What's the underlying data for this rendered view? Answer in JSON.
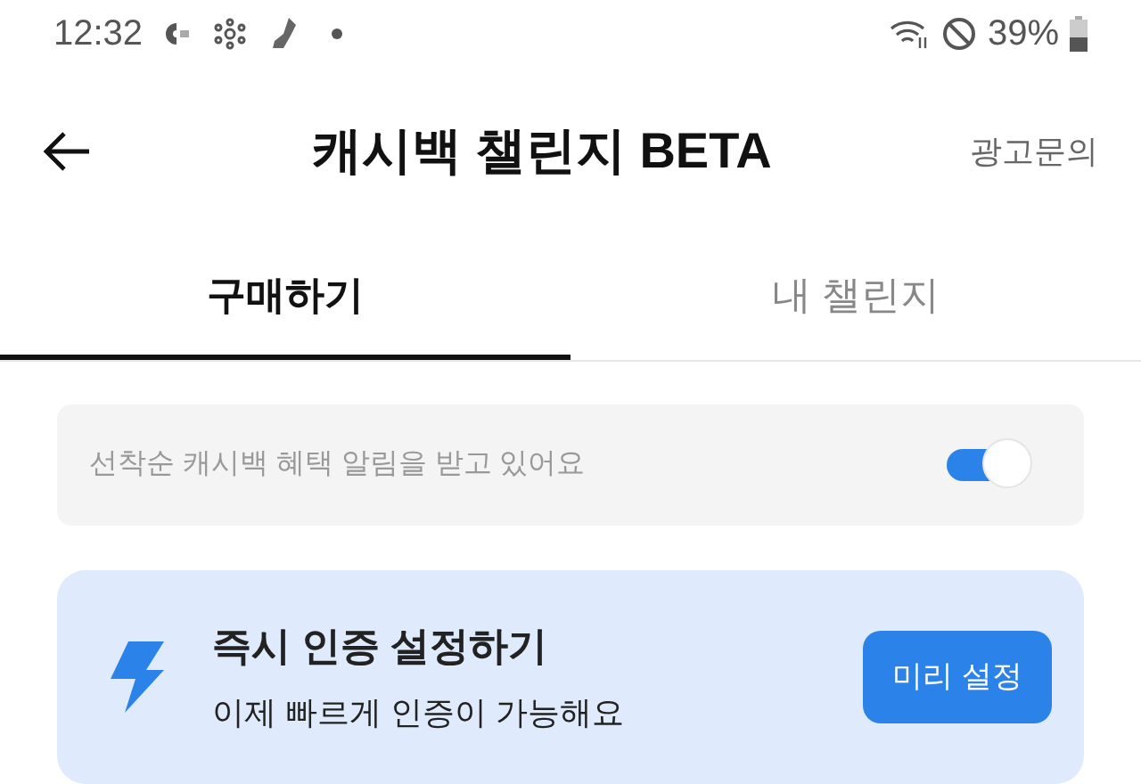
{
  "status_bar": {
    "time": "12:32",
    "battery": "39%"
  },
  "header": {
    "title": "캐시백 챌린지 BETA",
    "action": "광고문의"
  },
  "tabs": [
    {
      "label": "구매하기",
      "selected": true
    },
    {
      "label": "내 챌린지",
      "selected": false
    }
  ],
  "notification": {
    "text": "선착순 캐시백 혜택 알림을 받고 있어요",
    "on": true
  },
  "promo": {
    "title": "즉시 인증 설정하기",
    "subtitle": "이제 빠르게 인증이 가능해요",
    "button": "미리 설정"
  }
}
